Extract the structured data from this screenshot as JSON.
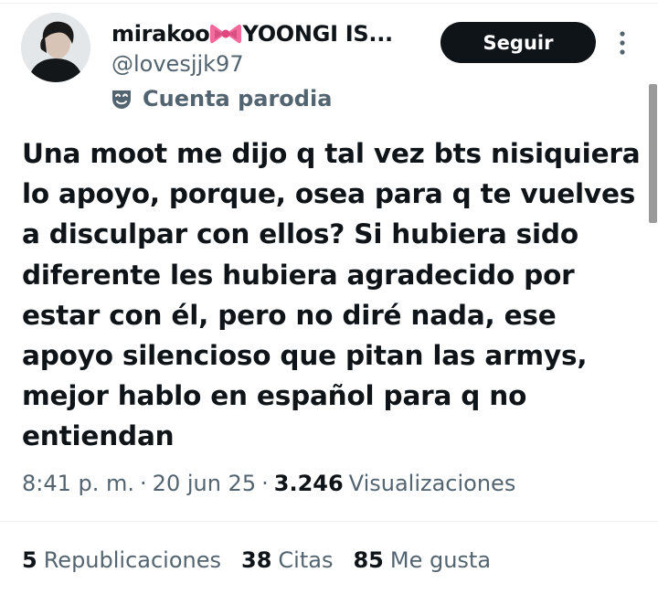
{
  "author": {
    "display_name_prefix": "mirakoo",
    "display_name_suffix": "YOONGI IS...",
    "name_emoji": "ribbon-bow",
    "handle": "@lovesjjk97",
    "account_label": "Cuenta parodia",
    "account_label_icon": "parody-mask-icon"
  },
  "actions": {
    "follow_label": "Seguir",
    "more_icon": "more-vertical-icon"
  },
  "tweet": {
    "text": "Una moot me dijo q tal vez bts nisiquiera\nlo apoyo, porque, osea para q te vuelves\na disculpar con ellos? Si hubiera sido\ndiferente les hubiera agradecido por\nestar con él, pero no diré nada, ese\napoyo silencioso que pitan las armys,\nmejor hablo en español para q no\nentiendan",
    "time": "8:41 p. m.",
    "separator": "·",
    "date": "20 jun 25",
    "views_count": "3.246",
    "views_label": "Visualizaciones"
  },
  "stats": {
    "reposts_count": "5",
    "reposts_label": "Republicaciones",
    "quotes_count": "38",
    "quotes_label": "Citas",
    "likes_count": "85",
    "likes_label": "Me gusta"
  },
  "colors": {
    "text_primary": "#0f1419",
    "text_secondary": "#536471",
    "button_bg": "#0f1419",
    "divider": "#eff3f4",
    "ribbon": "#f26b9c"
  }
}
